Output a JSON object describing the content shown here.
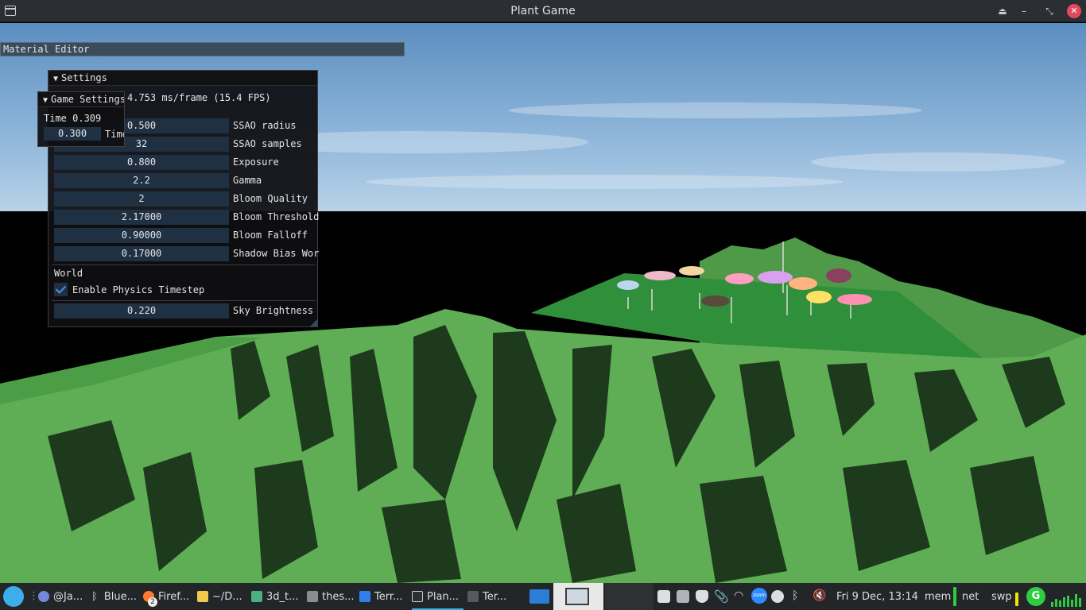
{
  "window": {
    "title": "Plant Game"
  },
  "material_editor": {
    "title": "Material Editor"
  },
  "settings": {
    "title": "Settings",
    "fps_text": "4.753 ms/frame (15.4 FPS)",
    "rows": [
      {
        "value": "0.500",
        "label": "SSAO radius"
      },
      {
        "value": "32",
        "label": "SSAO samples"
      },
      {
        "value": "0.800",
        "label": "Exposure"
      },
      {
        "value": "2.2",
        "label": "Gamma"
      },
      {
        "value": "2",
        "label": "Bloom Quality"
      },
      {
        "value": "2.17000",
        "label": "Bloom Threshold"
      },
      {
        "value": "0.90000",
        "label": "Bloom Falloff"
      },
      {
        "value": "0.17000",
        "label": "Shadow Bias Wor"
      }
    ],
    "world_header": "World",
    "physics_checkbox": {
      "label": "Enable Physics Timestep",
      "checked": true
    },
    "sky": {
      "value": "0.220",
      "label": "Sky Brightness"
    }
  },
  "game_settings": {
    "title": "Game Settings",
    "time_text": "Time 0.309",
    "field_value": "0.300",
    "field_label": "Time"
  },
  "taskbar": {
    "tasks": [
      "@Ja...",
      "Blue...",
      "Firef...",
      "~/D...",
      "3d_t...",
      "thes...",
      "Terr...",
      "Plan...",
      "Ter..."
    ],
    "firefox_badge": "2",
    "clock": "Fri 9 Dec, 13:14",
    "mem_label": "mem",
    "net_label": "net",
    "swap_label": "swp",
    "zoom_label": "zoom"
  },
  "colors": {
    "sky_top": "#5b8ec0",
    "sky_bottom": "#a8c8e4",
    "terrain_light": "#5fae55",
    "terrain_dark": "#1d3a1c",
    "plateau": "#2f8f3b",
    "imgui_field": "#203043",
    "taskbar_bg": "#232629",
    "accent": "#3daee9"
  }
}
